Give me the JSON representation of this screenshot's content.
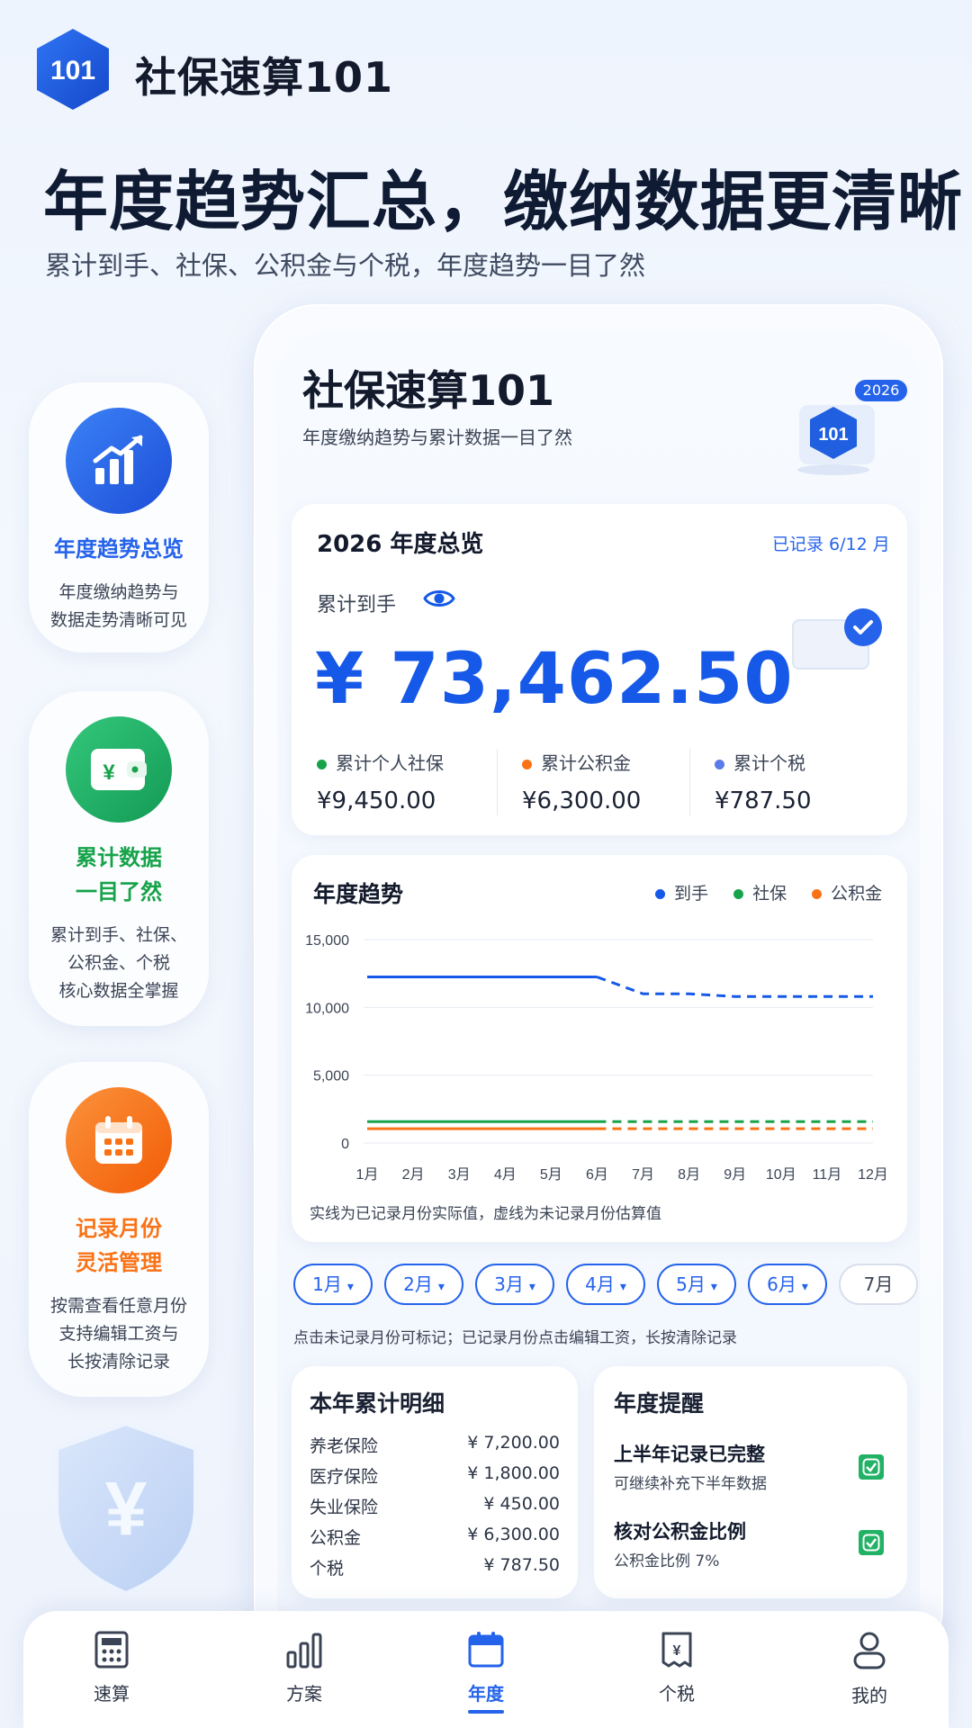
{
  "brand": {
    "logo_text": "101",
    "name": "社保速算101"
  },
  "headline": "年度趋势汇总，缴纳数据更清晰",
  "subhead": "累计到手、社保、公积金与个税，年度趋势一目了然",
  "features": [
    {
      "title": "年度趋势总览",
      "desc": [
        "年度缴纳趋势与",
        "数据走势清晰可见"
      ],
      "color": "#2563eb"
    },
    {
      "title": [
        "累计数据",
        "一目了然"
      ],
      "desc": [
        "累计到手、社保、",
        "公积金、个税",
        "核心数据全掌握"
      ],
      "color": "#16a34a",
      "icon_text": "¥"
    },
    {
      "title": [
        "记录月份",
        "灵活管理"
      ],
      "desc": [
        "按需查看任意月份",
        "支持编辑工资与",
        "长按清除记录"
      ],
      "color": "#f97316"
    }
  ],
  "shield_icon_text": "¥",
  "app": {
    "title": "社保速算101",
    "subtitle": "年度缴纳趋势与累计数据一目了然",
    "logo_text": "101",
    "year_badge": "2026"
  },
  "overview": {
    "title": "2026 年度总览",
    "recorded": "已记录 6/12 月",
    "net_label": "累计到手",
    "net_amount": "¥ 73,462.50",
    "stats": [
      {
        "label": "累计个人社保",
        "value": "¥9,450.00",
        "color": "#16a34a"
      },
      {
        "label": "累计公积金",
        "value": "¥6,300.00",
        "color": "#f97316"
      },
      {
        "label": "累计个税",
        "value": "¥787.50",
        "color": "#5b7be8"
      }
    ]
  },
  "trend": {
    "title": "年度趋势",
    "note": "实线为已记录月份实际值，虚线为未记录月份估算值"
  },
  "chart_data": {
    "type": "line",
    "categories": [
      "1月",
      "2月",
      "3月",
      "4月",
      "5月",
      "6月",
      "7月",
      "8月",
      "9月",
      "10月",
      "11月",
      "12月"
    ],
    "ylim": [
      0,
      15000
    ],
    "yticks": [
      "0",
      "5,000",
      "10,000",
      "15,000"
    ],
    "recorded_months": 6,
    "grid": true,
    "legend_position": "top-right",
    "series": [
      {
        "name": "到手",
        "color": "#1659e8",
        "values": [
          12243,
          12243,
          12243,
          12243,
          12243,
          12243,
          11000,
          11000,
          10800,
          10800,
          10800,
          10800
        ]
      },
      {
        "name": "社保",
        "color": "#16a34a",
        "values": [
          1575,
          1575,
          1575,
          1575,
          1575,
          1575,
          1575,
          1575,
          1575,
          1575,
          1575,
          1575
        ]
      },
      {
        "name": "公积金",
        "color": "#f97316",
        "values": [
          1050,
          1050,
          1050,
          1050,
          1050,
          1050,
          1050,
          1050,
          1050,
          1050,
          1050,
          1050
        ]
      }
    ]
  },
  "months": [
    {
      "label": "1月",
      "active": true
    },
    {
      "label": "2月",
      "active": true
    },
    {
      "label": "3月",
      "active": true
    },
    {
      "label": "4月",
      "active": true
    },
    {
      "label": "5月",
      "active": true
    },
    {
      "label": "6月",
      "active": true
    },
    {
      "label": "7月",
      "active": false
    }
  ],
  "month_dropdown_glyph": "▾",
  "hint": "点击未记录月份可标记；已记录月份点击编辑工资，长按清除记录",
  "detail": {
    "title": "本年累计明细",
    "rows": [
      {
        "label": "养老保险",
        "value": "¥ 7,200.00"
      },
      {
        "label": "医疗保险",
        "value": "¥ 1,800.00"
      },
      {
        "label": "失业保险",
        "value": "¥ 450.00"
      },
      {
        "label": "公积金",
        "value": "¥ 6,300.00"
      },
      {
        "label": "个税",
        "value": "¥ 787.50"
      }
    ]
  },
  "reminders": {
    "title": "年度提醒",
    "items": [
      {
        "title": "上半年记录已完整",
        "sub": "可继续补充下半年数据",
        "checked": true
      },
      {
        "title": "核对公积金比例",
        "sub": "公积金比例 7%",
        "checked": true
      }
    ]
  },
  "nav": {
    "items": [
      {
        "label": "速算",
        "icon": "calculator-icon"
      },
      {
        "label": "方案",
        "icon": "bar-chart-icon"
      },
      {
        "label": "年度",
        "icon": "calendar-icon",
        "active": true
      },
      {
        "label": "个税",
        "icon": "tax-receipt-icon",
        "icon_text": "¥"
      },
      {
        "label": "我的",
        "icon": "user-icon"
      }
    ]
  }
}
